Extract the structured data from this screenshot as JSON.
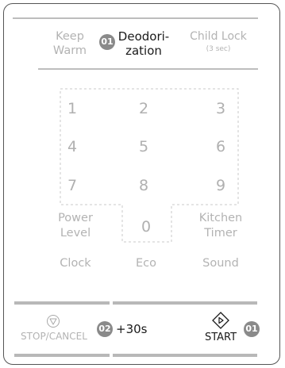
{
  "top_row": {
    "keep_warm": [
      "Keep",
      "Warm"
    ],
    "deodorization": [
      "Deodori-",
      "zation"
    ],
    "deodorization_badge": "01",
    "child_lock": "Child Lock",
    "child_lock_sub": "(3 sec)"
  },
  "keypad": {
    "digits": [
      "1",
      "2",
      "3",
      "4",
      "5",
      "6",
      "7",
      "8",
      "9",
      "0"
    ],
    "power_level": [
      "Power",
      "Level"
    ],
    "kitchen_timer": [
      "Kitchen",
      "Timer"
    ],
    "clock": "Clock",
    "eco": "Eco",
    "sound": "Sound"
  },
  "bottom_row": {
    "stop_cancel": "STOP/CANCEL",
    "plus30_badge": "02",
    "plus30": "+30s",
    "start": "START",
    "start_badge": "01"
  },
  "colors": {
    "text_dim": "#b3b3b3",
    "text_active": "#1a1a1a",
    "badge": "#8a8a8a",
    "frame": "#555555"
  }
}
